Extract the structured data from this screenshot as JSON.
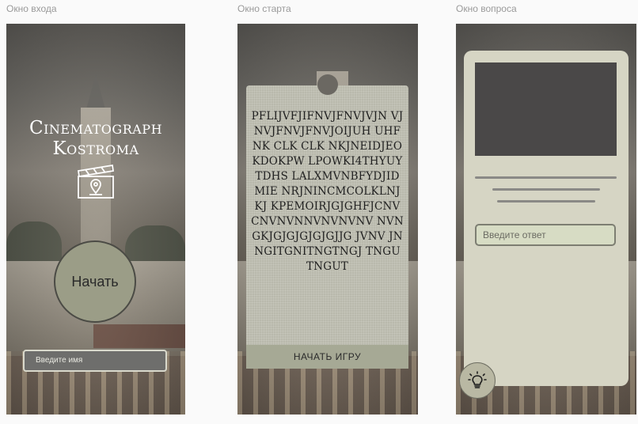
{
  "frames": [
    {
      "label": "Окно входа"
    },
    {
      "label": "Окно старта"
    },
    {
      "label": "Окно вопроса"
    }
  ],
  "login": {
    "title_line1": "Cinematograph",
    "title_line2": "Kostroma",
    "logo_icon": "clapperboard-location-icon",
    "start_label": "Начать",
    "name_placeholder": "Введите имя"
  },
  "start": {
    "rules_text": "PFLIJVFJIFNVJFNVJVJN VJNVJFNVJFNVJOIJUH UHFNK CLK CLK NKJNEIDJEOKDOKPW LPOWKI4THYUYTDHS LALXMVNBFYDJIDMIE NRJNINCMCOLKLNJKJ KPEMOIRJGJGHFJCNV CNVNVNNVNVNVNV NVNGKJGJGJGJGJGJJG JVNV JNNGITGNITNGTNGJ TNGUTNGUT",
    "start_game_label": "НАЧАТЬ ИГРУ"
  },
  "question": {
    "answer_placeholder": "Введите ответ",
    "hint_icon": "lightbulb-icon"
  },
  "colors": {
    "button_fill": "#9b9d87",
    "card_bg": "#d6d5c4",
    "ticket_bg": "#b9b9ac",
    "image_placeholder": "#4a4848"
  }
}
